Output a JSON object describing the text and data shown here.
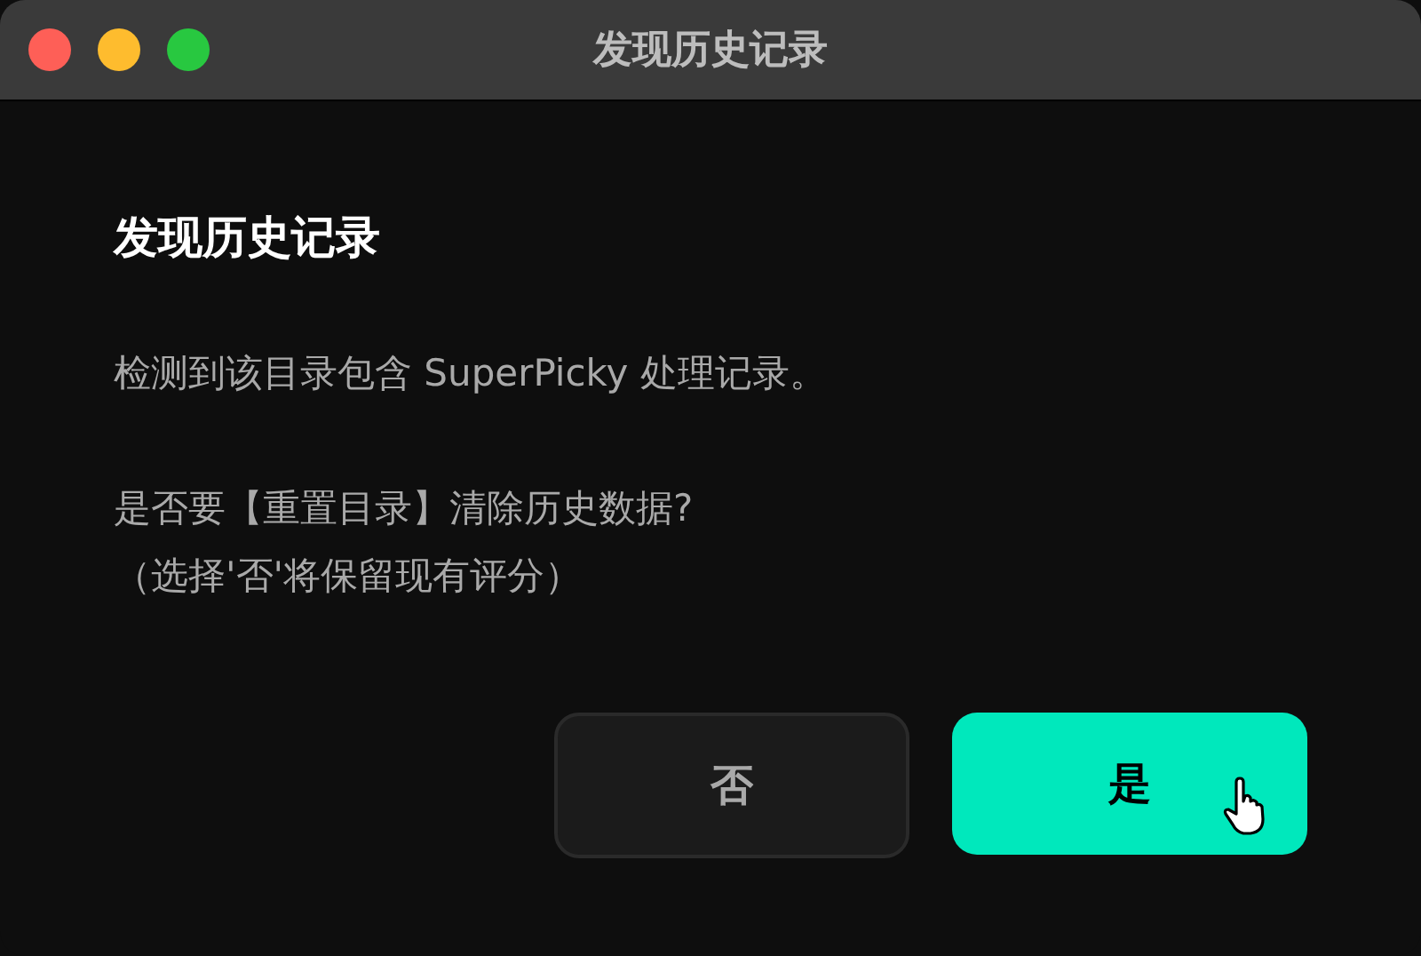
{
  "window": {
    "title": "发现历史记录"
  },
  "dialog": {
    "heading": "发现历史记录",
    "paragraphs": [
      [
        "检测到该目录包含 SuperPicky 处理记录。"
      ],
      [
        "是否要【重置目录】清除历史数据?",
        "（选择'否'将保留现有评分）"
      ]
    ],
    "buttons": [
      {
        "label": "否",
        "kind": "secondary",
        "hovered": false
      },
      {
        "label": "是",
        "kind": "primary",
        "hovered": true
      }
    ]
  }
}
